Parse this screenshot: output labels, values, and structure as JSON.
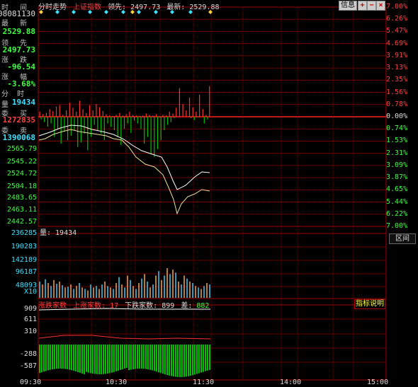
{
  "header": {
    "tab_label": "分时走势",
    "index_name": "上证指数",
    "prev_label": "领先:",
    "prev_value": "2497.73",
    "latest_label": "最新:",
    "latest_value": "2529.88"
  },
  "buttons": {
    "info": "信息",
    "plus": "+",
    "minus": "−",
    "close": "×"
  },
  "left_panel": {
    "time_label": "时 间",
    "time_value": "08081130",
    "latest_label": "最 新",
    "latest_value": "2529.88",
    "lead_label": "领 先",
    "lead_value": "2497.73",
    "change_label": "涨 跌",
    "change_value": "-96.54",
    "pct_label": "涨 幅",
    "pct_value": "-3.68%",
    "vol_label": "分 时 量",
    "vol_value": "19434",
    "buy_label": "委 买",
    "buy_value": "1272835",
    "sell_label": "委 卖",
    "sell_value": "1390068"
  },
  "price_axis": {
    "left_labels": [
      "2565.79",
      "2545.22",
      "2524.72",
      "2504.18",
      "2483.65",
      "2463.11",
      "2442.57"
    ],
    "right_labels": [
      "7.00%",
      "6.26%",
      "5.47%",
      "4.69%",
      "3.91%",
      "3.13%",
      "2.35%",
      "1.56%",
      "0.78%",
      "0.00%",
      "0.74%",
      "1.53%",
      "2.31%",
      "3.09%",
      "3.87%",
      "4.65%",
      "5.44%",
      "6.22%",
      "7.00%"
    ]
  },
  "volume_panel": {
    "caption": "量: 19434",
    "interval_button": "区间",
    "axis_labels": [
      "236285",
      "190283",
      "142189",
      "96187",
      "48093",
      "X10"
    ]
  },
  "breadth_panel": {
    "caption_prefix": "涨跌家数",
    "up_label": "上涨家数:",
    "up_value": "17",
    "down_label": "下跌家数:",
    "down_value": "899",
    "diff_label": "差:",
    "diff_value": "882",
    "help_button": "指标说明",
    "axis_labels": [
      "909",
      "611",
      "310",
      "",
      "-288",
      "-587"
    ]
  },
  "time_axis": [
    "09:30",
    "10:30",
    "11:30",
    "14:00",
    "15:00"
  ],
  "colors": {
    "grid": "#a00000",
    "up": "#ff3030",
    "down": "#00c000",
    "price_line": "#ffffff",
    "avg_line": "#f0e0a0",
    "label_green": "#40ff40",
    "label_cyan": "#40e0ff",
    "label_red": "#ff4040"
  }
}
